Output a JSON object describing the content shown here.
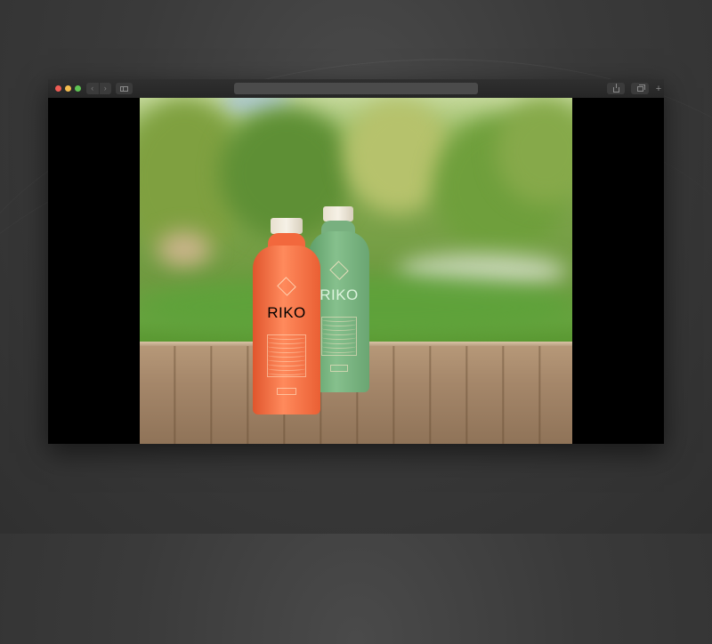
{
  "window": {
    "title": "",
    "address": "",
    "toolbar_icons": [
      "close-icon",
      "minimize-icon",
      "zoom-icon",
      "back-icon",
      "forward-icon",
      "sidebar-icon",
      "share-icon",
      "tabs-icon",
      "plus-icon"
    ],
    "back_glyph": "‹",
    "forward_glyph": "›",
    "new_tab_glyph": "+"
  },
  "colors": {
    "close": "#ee5c54",
    "minimize": "#f4bd4f",
    "zoom": "#5fc454",
    "orange_bottle": "#f2693e",
    "green_bottle": "#72b17b"
  },
  "photo": {
    "bottles": [
      {
        "name": "RIKO",
        "color": "green"
      },
      {
        "name": "RIKO",
        "color": "orange"
      }
    ]
  }
}
